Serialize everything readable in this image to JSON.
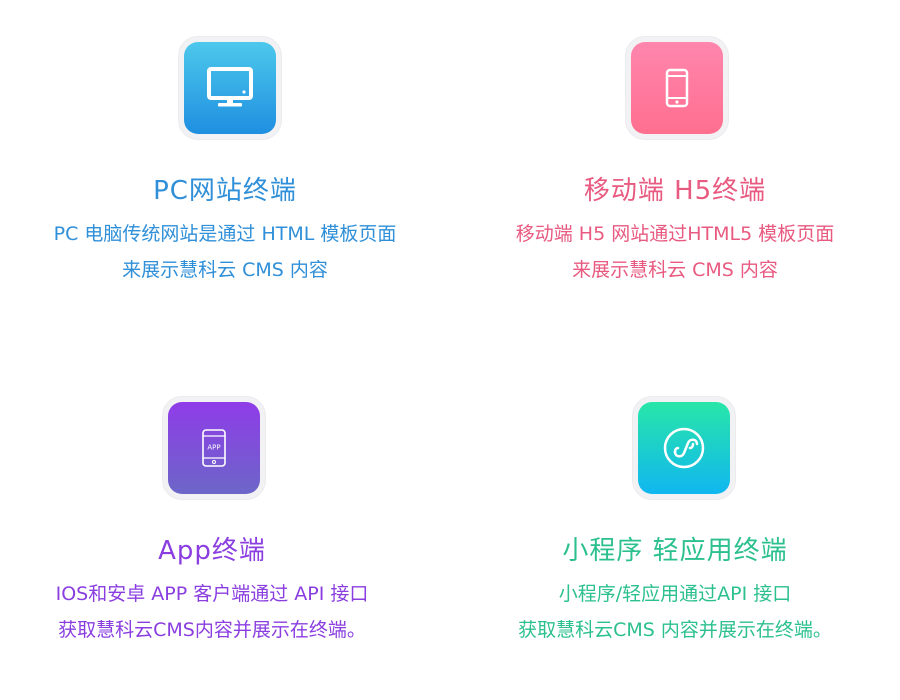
{
  "cards": [
    {
      "icon": "monitor-icon",
      "title": "PC网站终端",
      "desc_line1": "PC 电脑传统网站是通过 HTML 模板页面",
      "desc_line2": "来展示慧科云 CMS 内容",
      "color": "#2f8fd8"
    },
    {
      "icon": "smartphone-icon",
      "title": "移动端 H5终端",
      "desc_line1": "移动端 H5 网站通过HTML5 模板页面",
      "desc_line2": "来展示慧科云 CMS 内容",
      "color": "#e85a80"
    },
    {
      "icon": "app-phone-icon",
      "icon_text": "APP",
      "title": "App终端",
      "desc_line1": "IOS和安卓 APP 客户端通过 API 接口",
      "desc_line2": "获取慧科云CMS内容并展示在终端。",
      "color": "#8a3ee0"
    },
    {
      "icon": "mini-program-icon",
      "title": "小程序 轻应用终端",
      "desc_line1": "小程序/轻应用通过API 接口",
      "desc_line2": "获取慧科云CMS 内容并展示在终端。",
      "color": "#2cc08f"
    }
  ]
}
